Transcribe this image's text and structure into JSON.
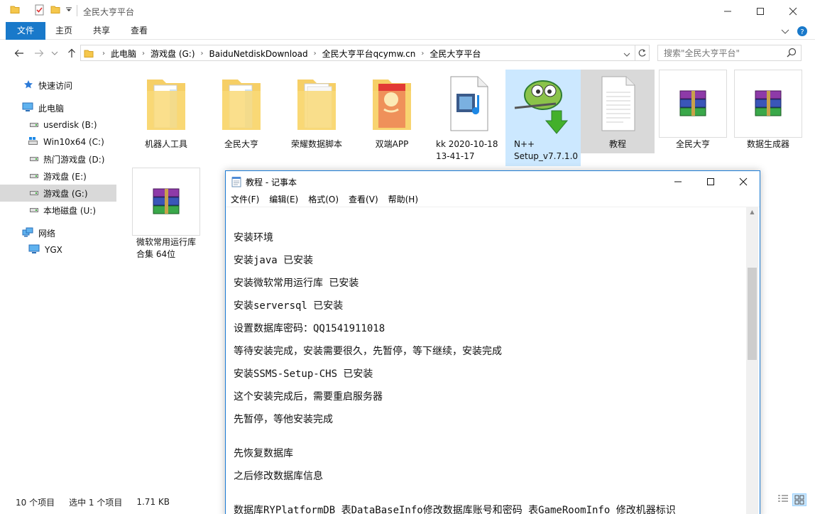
{
  "window": {
    "title": "全民大亨平台",
    "accent": "#1979ca"
  },
  "ribbon": {
    "tabs": [
      "文件",
      "主页",
      "共享",
      "查看"
    ]
  },
  "address": {
    "crumbs": [
      "此电脑",
      "游戏盘 (G:)",
      "BaiduNetdiskDownload",
      "全民大亨平台qcymw.cn",
      "全民大亨平台"
    ]
  },
  "search": {
    "placeholder": "搜索\"全民大亨平台\""
  },
  "sidebar": {
    "items": [
      {
        "label": "快速访问",
        "icon": "star-icon"
      },
      {
        "label": "此电脑",
        "icon": "computer-icon"
      },
      {
        "label": "userdisk (B:)",
        "icon": "drive-icon"
      },
      {
        "label": "Win10x64 (C:)",
        "icon": "windows-drive-icon"
      },
      {
        "label": "热门游戏盘 (D:)",
        "icon": "drive-icon"
      },
      {
        "label": "游戏盘 (E:)",
        "icon": "drive-icon"
      },
      {
        "label": "游戏盘 (G:)",
        "icon": "drive-icon"
      },
      {
        "label": "本地磁盘 (U:)",
        "icon": "drive-icon"
      },
      {
        "label": "网络",
        "icon": "network-icon"
      },
      {
        "label": "YGX",
        "icon": "monitor-icon"
      }
    ]
  },
  "files": [
    {
      "label": "机器人工具",
      "icon": "folder-icon"
    },
    {
      "label": "全民大亨",
      "icon": "folder-icon"
    },
    {
      "label": "荣耀数据脚本",
      "icon": "folder-icon"
    },
    {
      "label": "双端APP",
      "icon": "folder-icon"
    },
    {
      "label": "kk 2020-10-18 13-41-17",
      "icon": "media-file-icon"
    },
    {
      "label": "N++ Setup_v7.7.1.0",
      "icon": "notepad-plus-icon"
    },
    {
      "label": "教程",
      "icon": "text-file-icon"
    },
    {
      "label": "全民大亨",
      "icon": "winrar-icon"
    },
    {
      "label": "数据生成器",
      "icon": "winrar-icon"
    },
    {
      "label": "微软常用运行库合集 64位",
      "icon": "winrar-icon"
    }
  ],
  "status": {
    "count": "10 个项目",
    "selection": "选中 1 个项目",
    "size": "1.71 KB"
  },
  "notepad": {
    "title": "教程 - 记事本",
    "menu": [
      "文件(F)",
      "编辑(E)",
      "格式(O)",
      "查看(V)",
      "帮助(H)"
    ],
    "lines": [
      "安装环境",
      "安装java 已安装",
      "安装微软常用运行库  已安装",
      "安装serversql 已安装",
      "设置数据库密码：QQ1541911018",
      "等待安装完成，安装需要很久，先暂停，等下继续，安装完成",
      "安装SSMS-Setup-CHS 已安装",
      "这个安装完成后，需要重启服务器",
      "先暂停，等他安装完成",
      "先恢复数据库",
      "之后修改数据库信息",
      "数据库RYPlatformDB 表DataBaseInfo修改数据库账号和密码  表GameRoomInfo  修改机器标识"
    ]
  }
}
